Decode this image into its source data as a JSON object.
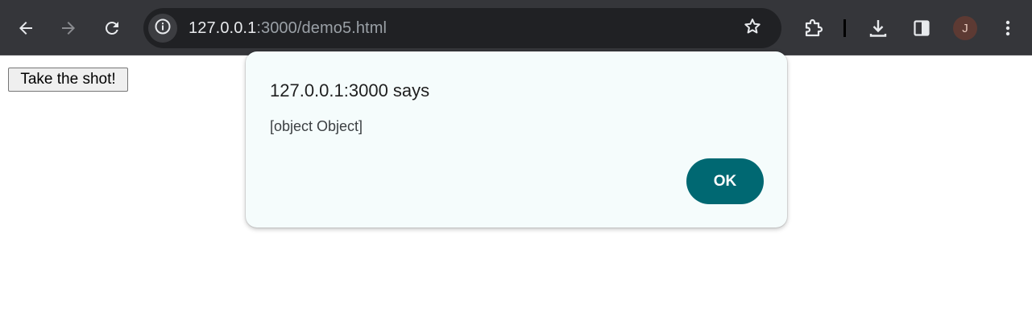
{
  "browser": {
    "url_host": "127.0.0.1",
    "url_path": ":3000/demo5.html",
    "profile_initial": "J",
    "icons": {
      "back": "back-arrow-icon",
      "forward": "forward-arrow-icon",
      "reload": "reload-icon",
      "site_info": "site-info-icon",
      "bookmark": "star-icon",
      "extensions": "puzzle-icon",
      "downloads": "download-icon",
      "side_panel": "side-panel-icon",
      "menu": "kebab-menu-icon"
    },
    "colors": {
      "toolbar": "#35363a",
      "omnibox": "#202124",
      "avatar": "#5d3a33"
    }
  },
  "page": {
    "button_label": "Take the shot!"
  },
  "dialog": {
    "title": "127.0.0.1:3000 says",
    "message": "[object Object]",
    "ok_label": "OK",
    "colors": {
      "background": "#f5fcfc",
      "ok_button": "#006872"
    }
  }
}
